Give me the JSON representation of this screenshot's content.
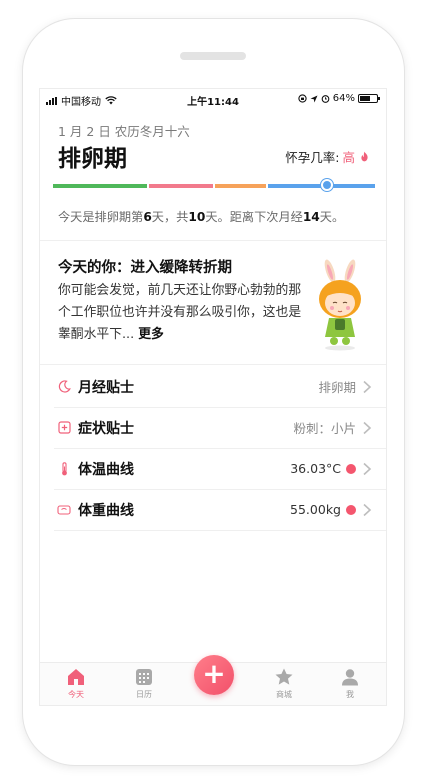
{
  "status_bar": {
    "carrier": "中国移动",
    "time": "上午11:44",
    "battery": "64%",
    "battery_level": 0.64
  },
  "header": {
    "date": "1 月 2 日  农历冬月十六",
    "phase_title": "排卵期",
    "preg_rate_label": "怀孕几率:",
    "preg_rate_value": "高",
    "colors": {
      "accent": "#f0607a"
    }
  },
  "cycle_bar": {
    "segments": [
      {
        "name": "green",
        "color": "#4fb85a"
      },
      {
        "name": "pink",
        "color": "#f27a8c"
      },
      {
        "name": "orange",
        "color": "#f6a25a"
      },
      {
        "name": "blue",
        "color": "#5aa2ec"
      }
    ],
    "marker_color": "#5aa2ec"
  },
  "cycle_info": {
    "t1": "今天是排卵期第",
    "day": "6",
    "t2": "天，共",
    "total": "10",
    "t3": "天。距离下次月经",
    "until": "14",
    "t4": "天。"
  },
  "today": {
    "title": "今天的你：进入缓降转折期",
    "body": "你可能会发觉，前几天还让你野心勃勃的那个工作职位也许并没有那么吸引你，这也是睾酮水平下...",
    "more": "更多"
  },
  "rows": [
    {
      "label": "月经贴士",
      "value": "排卵期",
      "icon": "moon-icon",
      "icon_color": "#f0607a"
    },
    {
      "label": "症状贴士",
      "value": "粉刺：小片",
      "icon": "plus-box-icon",
      "icon_color": "#f0607a"
    },
    {
      "label": "体温曲线",
      "value": "36.03°C",
      "icon": "thermometer-icon",
      "icon_color": "#f0607a"
    },
    {
      "label": "体重曲线",
      "value": "55.00kg",
      "icon": "scale-icon",
      "icon_color": "#f0607a"
    }
  ],
  "tabbar": {
    "tabs": [
      {
        "label": "今天",
        "icon": "home-icon"
      },
      {
        "label": "日历",
        "icon": "calendar-icon"
      },
      {
        "label": "商城",
        "icon": "star-icon"
      },
      {
        "label": "我",
        "icon": "user-icon"
      }
    ],
    "fab": "+"
  }
}
